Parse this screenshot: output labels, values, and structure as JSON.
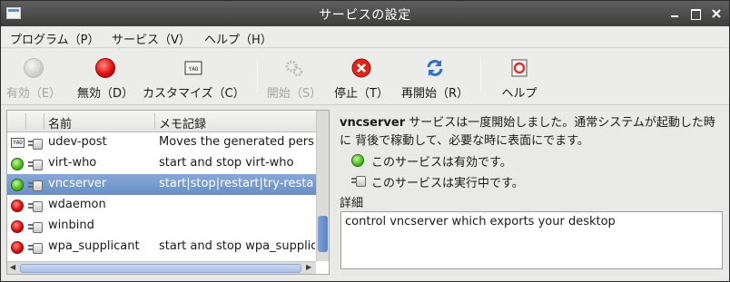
{
  "window": {
    "title": "サービスの設定"
  },
  "menubar": [
    {
      "label": "プログラム（P）"
    },
    {
      "label": "サービス（V）"
    },
    {
      "label": "ヘルプ（H）"
    }
  ],
  "toolbar": {
    "enable": "有効（E）",
    "disable": "無効（D）",
    "customize": "カスタマイズ（C）",
    "start": "開始（S）",
    "stop": "停止（T）",
    "restart": "再開始（R）",
    "help": "ヘルプ"
  },
  "list": {
    "headers": {
      "name": "名前",
      "memo": "メモ記録"
    },
    "rows": [
      {
        "status": "custom",
        "name": "udev-post",
        "desc": "Moves the generated pers",
        "selected": false
      },
      {
        "status": "green",
        "name": "virt-who",
        "desc": "start and stop virt-who",
        "selected": false
      },
      {
        "status": "green",
        "name": "vncserver",
        "desc": "start|stop|restart|try-resta",
        "selected": true
      },
      {
        "status": "red",
        "name": "wdaemon",
        "desc": "",
        "selected": false
      },
      {
        "status": "red",
        "name": "winbind",
        "desc": "",
        "selected": false
      },
      {
        "status": "red",
        "name": "wpa_supplicant",
        "desc": "start and stop wpa_supplic",
        "selected": false
      }
    ]
  },
  "details": {
    "service_name": "vncserver",
    "summary": " サービスは一度開始しました。通常システムが起動した時に 背後で稼動して、必要な時に表面にでます。",
    "enabled_text": "このサービスは有効です。",
    "running_text": "このサービスは実行中です。",
    "detail_label": "詳細",
    "detail_text": "control vncserver which exports your desktop"
  },
  "colors": {
    "selection": "#6b8fc5",
    "titlebar": "#4a4a4a"
  }
}
